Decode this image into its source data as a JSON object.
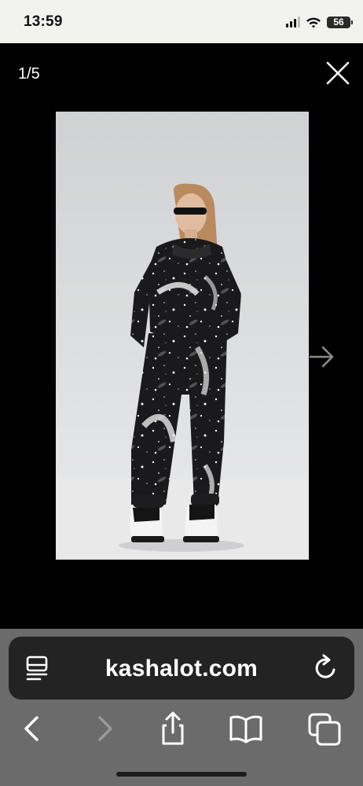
{
  "status_bar": {
    "time": "13:59",
    "battery_level": "56",
    "signal_icon": "cellular-signal-icon",
    "wifi_icon": "wifi-icon"
  },
  "viewer": {
    "counter": "1/5",
    "close_icon": "close-icon",
    "next_icon": "arrow-right-icon",
    "photo": "model-wearing-galaxy-print-hoodie-and-joggers"
  },
  "browser": {
    "url": "kashalot.com",
    "reader_icon": "page-menu-icon",
    "reload_icon": "reload-icon",
    "toolbar": {
      "back_icon": "back-chevron-icon",
      "forward_icon": "forward-chevron-icon",
      "share_icon": "share-icon",
      "bookmarks_icon": "book-icon",
      "tabs_icon": "tabs-icon"
    }
  },
  "colors": {
    "status_bar_bg": "#f2f2ef",
    "viewer_bg": "#000000",
    "chrome_bg": "#6b6b6b",
    "address_bar_bg": "#232323"
  }
}
